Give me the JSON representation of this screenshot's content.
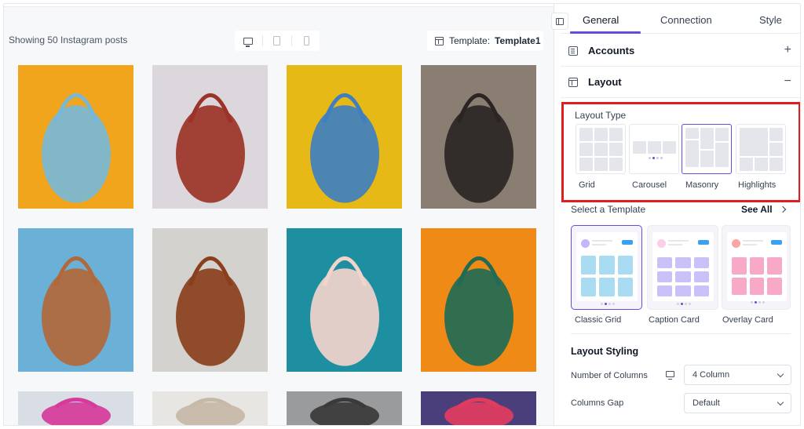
{
  "preview": {
    "count_text": "Showing 50 Instagram posts",
    "template_label": "Template:",
    "template_name": "Template1"
  },
  "tabs": [
    {
      "label": "General",
      "active": true
    },
    {
      "label": "Connection",
      "active": false
    },
    {
      "label": "Style",
      "active": false
    }
  ],
  "sections": {
    "accounts": {
      "label": "Accounts",
      "action": "+"
    },
    "layout": {
      "label": "Layout",
      "action": "−"
    }
  },
  "layout_type": {
    "title": "Layout Type",
    "options": [
      "Grid",
      "Carousel",
      "Masonry",
      "Highlights"
    ],
    "selected": "Masonry"
  },
  "templates": {
    "title": "Select a Template",
    "see_all": "See All",
    "items": [
      "Classic Grid",
      "Caption Card",
      "Overlay Card"
    ],
    "selected": "Classic Grid"
  },
  "layout_styling": {
    "title": "Layout Styling",
    "columns_label": "Number of Columns",
    "columns_value": "4 Column",
    "gap_label": "Columns Gap",
    "gap_value": "Default"
  },
  "colors": {
    "accent": "#6a4bd8",
    "highlight_box": "#e11d1d"
  },
  "posts": [
    {
      "name": "post-blue-bag",
      "bg": "#f0a51c",
      "fg": "#78b8d6"
    },
    {
      "name": "post-striped-bag",
      "bg": "#dcd7dc",
      "fg": "#9b3326"
    },
    {
      "name": "post-denim-bag",
      "bg": "#e7b917",
      "fg": "#3f7fc0"
    },
    {
      "name": "post-black-tote",
      "bg": "#8a7e72",
      "fg": "#2a2524"
    },
    {
      "name": "post-brown-crossbody",
      "bg": "#6bb0d6",
      "fg": "#b2683a"
    },
    {
      "name": "post-woven-bag",
      "bg": "#d4d2cf",
      "fg": "#8a3f1c"
    },
    {
      "name": "post-woman-suitcase",
      "bg": "#1d8fa0",
      "fg": "#f2d4cb"
    },
    {
      "name": "post-woman-sunglasses",
      "bg": "#f08a17",
      "fg": "#1f6b55"
    },
    {
      "name": "post-pink-top",
      "bg": "#d9dde5",
      "fg": "#d63a9a"
    },
    {
      "name": "post-bag-partial",
      "bg": "#e8e6e2",
      "fg": "#c5b9a7"
    },
    {
      "name": "post-woman-stripes",
      "bg": "#9a9b9c",
      "fg": "#3b3a3a"
    },
    {
      "name": "post-woman-pink",
      "bg": "#4a3f7a",
      "fg": "#e23b5f"
    }
  ]
}
